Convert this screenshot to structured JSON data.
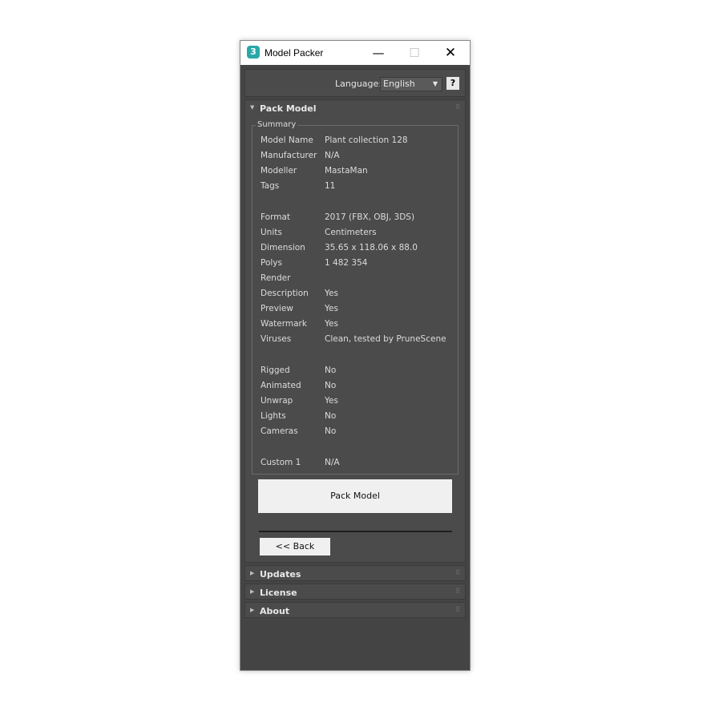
{
  "window": {
    "icon_glyph": "3",
    "title": "Model Packer",
    "minimize": "—",
    "maximize": "☐",
    "close": "✕"
  },
  "language": {
    "label": "Language:",
    "selected": "English",
    "arrow": "▼",
    "help": "?"
  },
  "rollouts": {
    "pack_model": {
      "title": "Pack Model",
      "expanded": true,
      "arrow": "▼"
    },
    "updates": {
      "title": "Updates",
      "expanded": false,
      "arrow": "▶"
    },
    "license": {
      "title": "License",
      "expanded": false,
      "arrow": "▶"
    },
    "about": {
      "title": "About",
      "expanded": false,
      "arrow": "▶"
    },
    "grip": "⠿"
  },
  "summary": {
    "legend": "Summary",
    "rows": [
      {
        "key": "Model Name",
        "value": "Plant collection 128"
      },
      {
        "key": "Manufacturer",
        "value": "N/A"
      },
      {
        "key": "Modeller",
        "value": "MastaMan"
      },
      {
        "key": "Tags",
        "value": "11"
      },
      {
        "key": "Format",
        "value": "2017 (FBX, OBJ, 3DS)"
      },
      {
        "key": "Units",
        "value": "Centimeters"
      },
      {
        "key": "Dimension",
        "value": "35.65 x 118.06 x 88.0"
      },
      {
        "key": "Polys",
        "value": "1 482 354"
      },
      {
        "key": "Render",
        "value": ""
      },
      {
        "key": "Description",
        "value": "Yes"
      },
      {
        "key": "Preview",
        "value": "Yes"
      },
      {
        "key": "Watermark",
        "value": "Yes"
      },
      {
        "key": "Viruses",
        "value": "Clean, tested by PruneScene"
      },
      {
        "key": "Rigged",
        "value": "No"
      },
      {
        "key": "Animated",
        "value": "No"
      },
      {
        "key": "Unwrap",
        "value": "Yes"
      },
      {
        "key": "Lights",
        "value": "No"
      },
      {
        "key": "Cameras",
        "value": "No"
      },
      {
        "key": "Custom 1",
        "value": "N/A"
      }
    ]
  },
  "buttons": {
    "pack_model": "Pack Model",
    "back": "<< Back"
  },
  "icons": {
    "app": "3ds-max-icon",
    "help": "help-icon",
    "dropdown": "chevron-down-icon",
    "expanded": "triangle-down-icon",
    "collapsed": "triangle-right-icon",
    "grip": "grip-dots-icon"
  },
  "colors": {
    "panel": "#444444",
    "rollout": "#4b4b4b",
    "app_icon": "#2aa7a7",
    "button": "#f0f0f0"
  }
}
